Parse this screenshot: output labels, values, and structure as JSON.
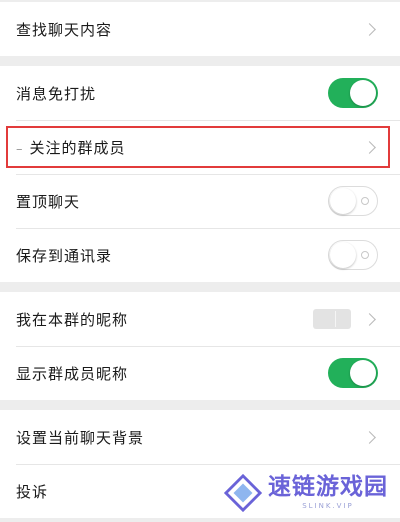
{
  "sections": [
    {
      "rows": [
        {
          "label": "查找聊天内容",
          "control": "chevron"
        }
      ]
    },
    {
      "rows": [
        {
          "label": "消息免打扰",
          "control": "toggle-on"
        },
        {
          "label": "关注的群成员",
          "control": "chevron",
          "highlighted": true
        },
        {
          "label": "置顶聊天",
          "control": "toggle-off"
        },
        {
          "label": "保存到通讯录",
          "control": "toggle-off"
        }
      ]
    },
    {
      "rows": [
        {
          "label": "我在本群的昵称",
          "control": "chevron"
        },
        {
          "label": "显示群成员昵称",
          "control": "toggle-on"
        }
      ]
    },
    {
      "rows": [
        {
          "label": "设置当前聊天背景",
          "control": "chevron"
        },
        {
          "label": "投诉",
          "control": "none"
        }
      ]
    }
  ],
  "colors": {
    "toggle_on": "#22b05a",
    "highlight": "#e23b3b",
    "background": "#ededed"
  },
  "watermark": {
    "logo_icon": "diamond-logo-icon",
    "text": "速链游戏园",
    "subtext": "SLINK.VIP"
  }
}
